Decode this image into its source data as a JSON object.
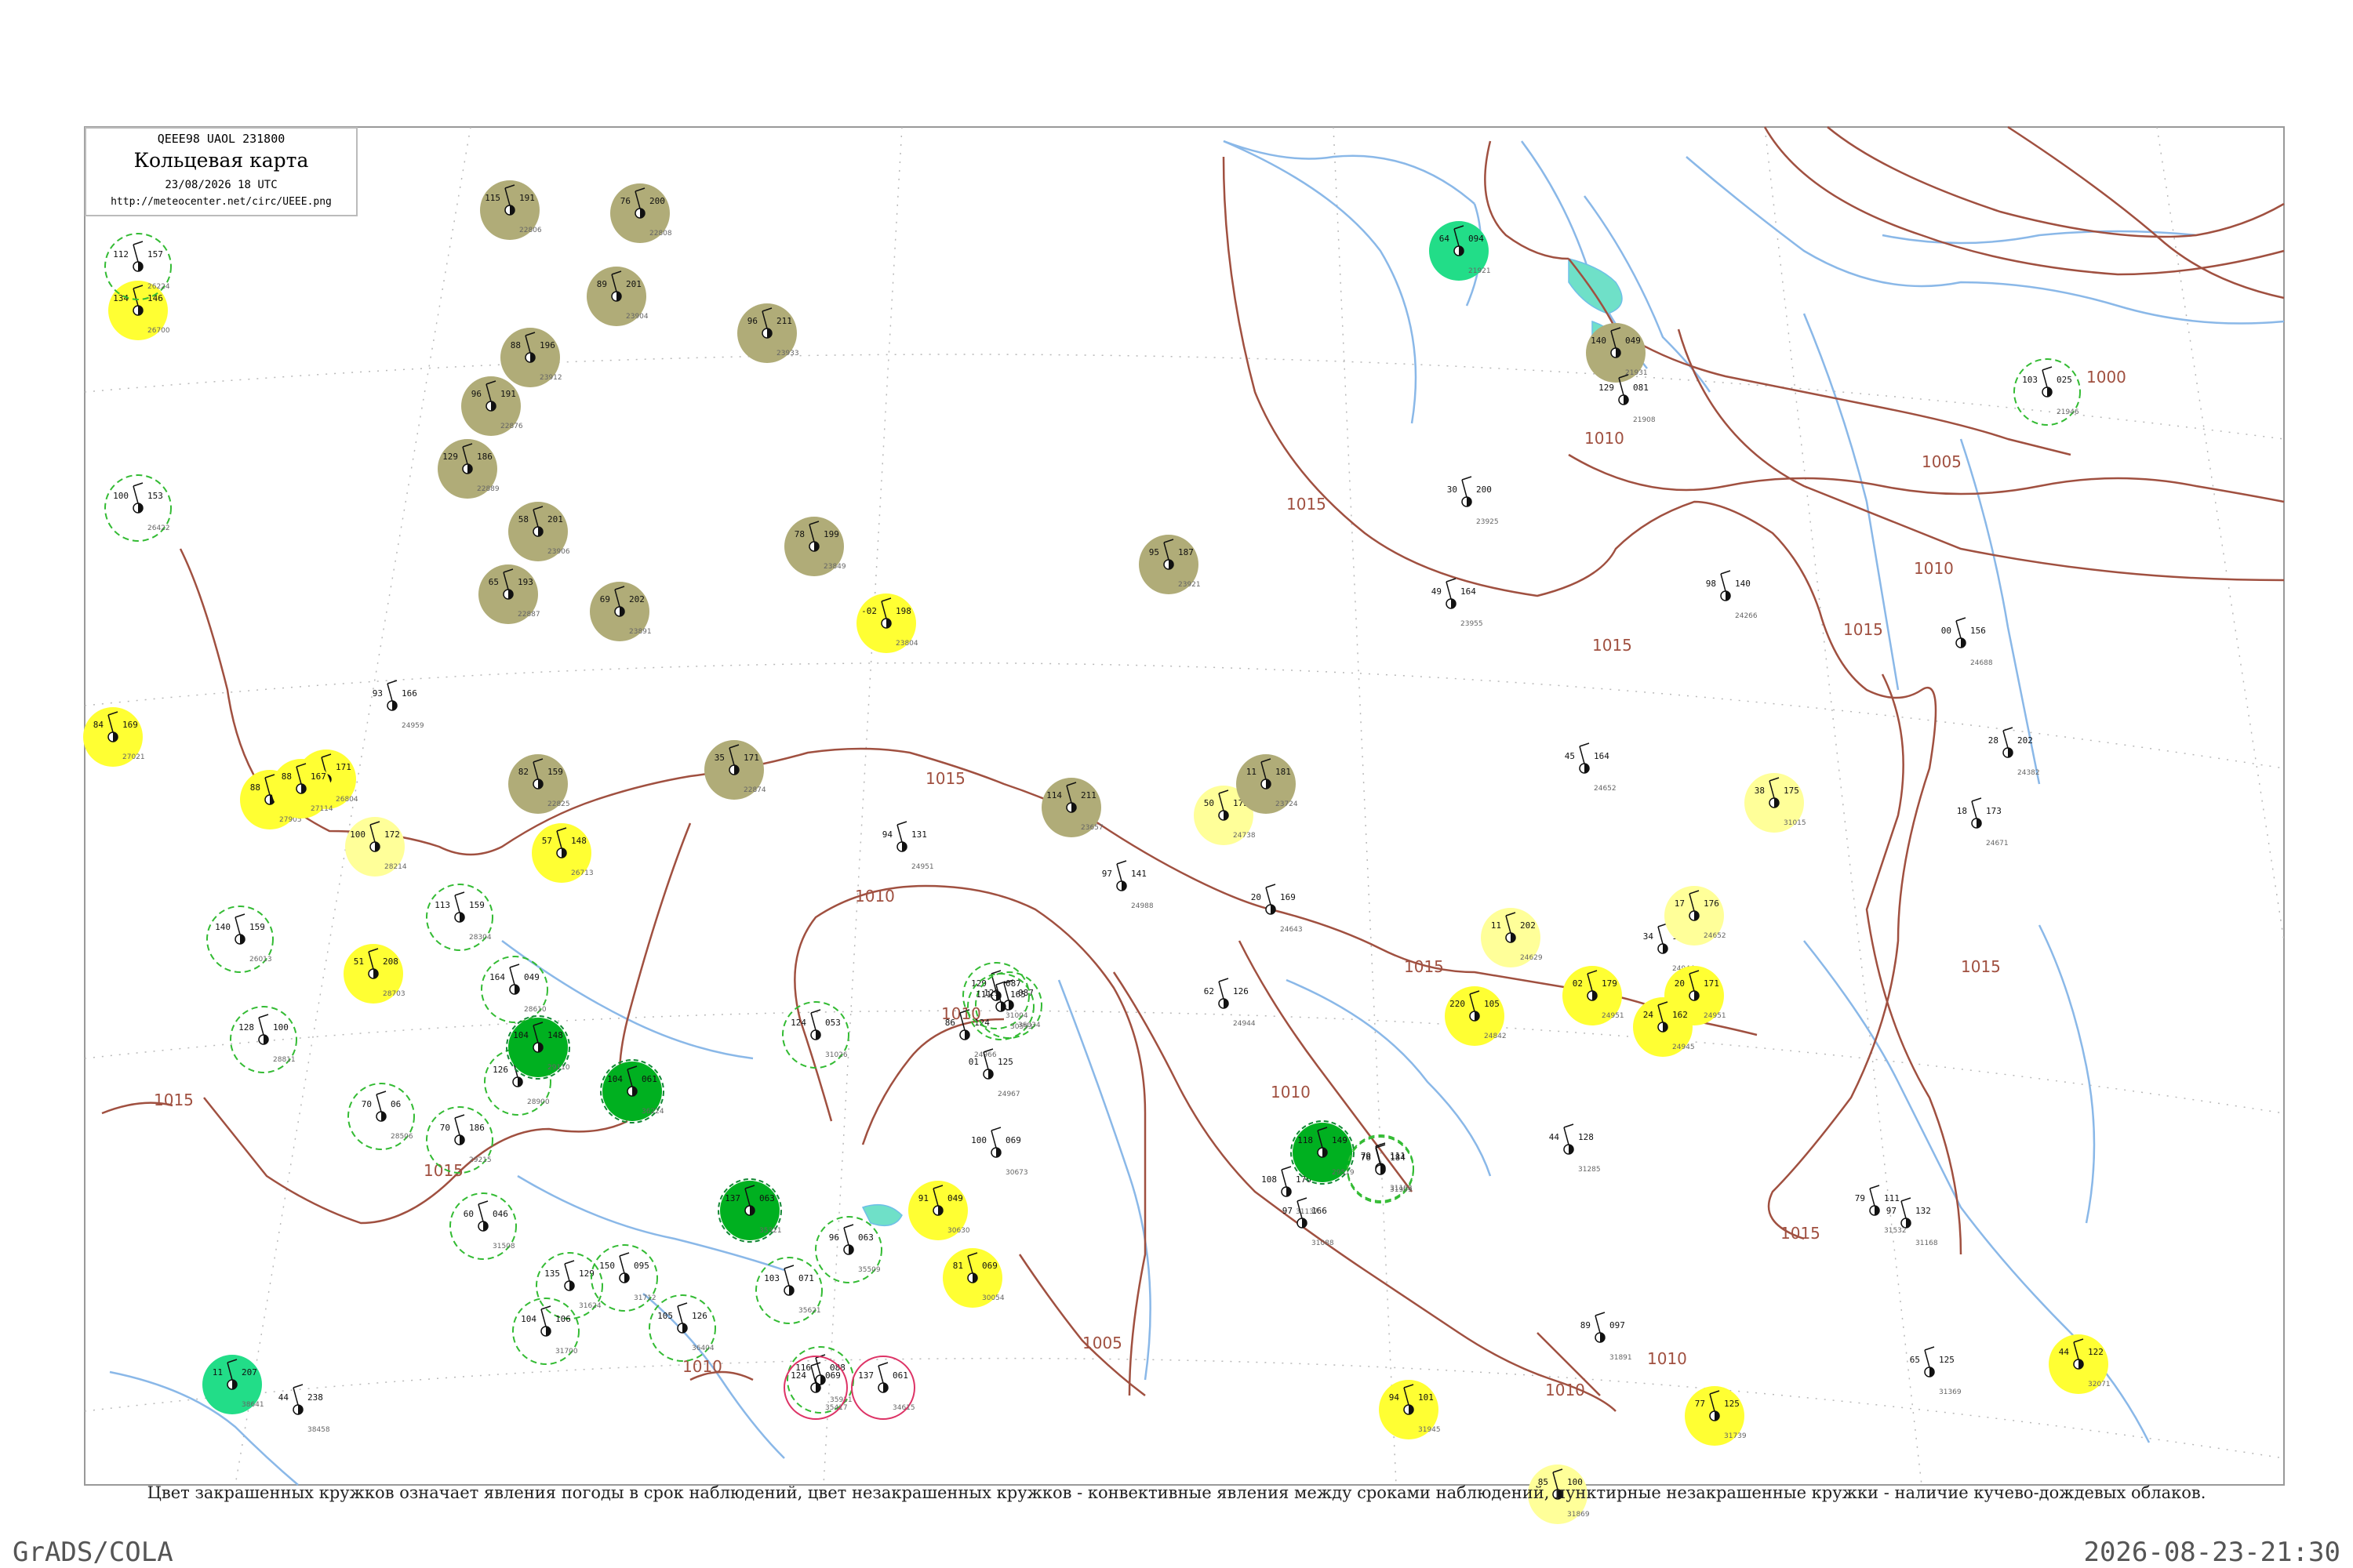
{
  "header": {
    "code_line": "QEEE98  UAOL  231800",
    "title": "Кольцевая карта",
    "datetime": "23/08/2026 18 UTC",
    "url": "http://meteocenter.net/circ/UEEE.png"
  },
  "caption": "Цвет закрашенных кружков означает явления погоды в срок наблюдений, цвет незакрашенных кружков - конвективные явления между сроками наблюдений, пунктирные незакрашенные кружки - наличие кучево-дождевых облаков.",
  "footer": {
    "left": "GrADS/COLA",
    "right": "2026-08-23-21:30"
  },
  "colors": {
    "isobar": "#a05040",
    "river": "#8ab8e8",
    "grid": "#b0b0b0",
    "frame": "#999999",
    "fog_fill": "#b0ac78",
    "haze_fill": "#ffff33",
    "pale_fill": "#ffff99",
    "rain_fill": "#00b020",
    "shower_fill": "#22dd88",
    "cb_ring": "#33bb33",
    "storm_ring": "#dd3366"
  },
  "isobar_labels": [
    "1015",
    "1015",
    "1015",
    "1015",
    "1015",
    "1015",
    "1015",
    "1015",
    "1015",
    "1010",
    "1010",
    "1010",
    "1010",
    "1010",
    "1010",
    "1010",
    "1010",
    "1005",
    "1005",
    "1000"
  ],
  "stations": [
    {
      "id": "24959",
      "t": "93",
      "p": "166"
    },
    {
      "id": "24951",
      "t": "94",
      "p": "131"
    },
    {
      "id": "24988",
      "t": "97",
      "p": "141"
    },
    {
      "id": "24944",
      "t": "62",
      "p": "126"
    },
    {
      "id": "24966",
      "t": "86",
      "p": "124"
    },
    {
      "id": "24967",
      "t": "01",
      "p": "125"
    },
    {
      "id": "31004",
      "t": "129",
      "p": "087"
    },
    {
      "id": "31026",
      "t": "124",
      "p": "053"
    },
    {
      "id": "30054",
      "t": "81",
      "p": "069"
    },
    {
      "id": "31137",
      "t": "108",
      "p": "176"
    },
    {
      "id": "31102",
      "t": "79",
      "p": "111"
    },
    {
      "id": "30673",
      "t": "100",
      "p": "069"
    },
    {
      "id": "31088",
      "t": "97",
      "p": "166"
    },
    {
      "id": "24266",
      "t": "98",
      "p": "140"
    },
    {
      "id": "24688",
      "t": "00",
      "p": "156"
    },
    {
      "id": "24382",
      "t": "28",
      "p": "202"
    },
    {
      "id": "24671",
      "t": "18",
      "p": "173"
    },
    {
      "id": "24738",
      "t": "50",
      "p": "173"
    },
    {
      "id": "24643",
      "t": "20",
      "p": "169"
    },
    {
      "id": "24652",
      "t": "45",
      "p": "164"
    },
    {
      "id": "24944",
      "t": "34",
      "p": "179"
    },
    {
      "id": "24951",
      "t": "02",
      "p": "179"
    },
    {
      "id": "31168",
      "t": "97",
      "p": "132"
    },
    {
      "id": "31369",
      "t": "65",
      "p": "125"
    },
    {
      "id": "21921",
      "t": "64",
      "p": "094"
    },
    {
      "id": "21946",
      "t": "103",
      "p": "025"
    },
    {
      "id": "21931",
      "t": "140",
      "p": "049"
    },
    {
      "id": "21908",
      "t": "129",
      "p": "081"
    },
    {
      "id": "23925",
      "t": "30",
      "p": "200"
    },
    {
      "id": "23955",
      "t": "49",
      "p": "164"
    },
    {
      "id": "23921",
      "t": "95",
      "p": "187"
    },
    {
      "id": "23804",
      "t": "-02",
      "p": "198"
    },
    {
      "id": "23849",
      "t": "78",
      "p": "199"
    },
    {
      "id": "23933",
      "t": "96",
      "p": "211"
    },
    {
      "id": "22887",
      "t": "65",
      "p": "193"
    },
    {
      "id": "23891",
      "t": "69",
      "p": "202"
    },
    {
      "id": "22806",
      "t": "115",
      "p": "191"
    },
    {
      "id": "22808",
      "t": "76",
      "p": "200"
    },
    {
      "id": "23904",
      "t": "89",
      "p": "201"
    },
    {
      "id": "23912",
      "t": "88",
      "p": "196"
    },
    {
      "id": "22876",
      "t": "96",
      "p": "191"
    },
    {
      "id": "22889",
      "t": "129",
      "p": "186"
    },
    {
      "id": "23906",
      "t": "58",
      "p": "201"
    },
    {
      "id": "22825",
      "t": "82",
      "p": "159"
    },
    {
      "id": "22874",
      "t": "35",
      "p": "171"
    },
    {
      "id": "23657",
      "t": "114",
      "p": "211"
    },
    {
      "id": "23724",
      "t": "11",
      "p": "181"
    },
    {
      "id": "26713",
      "t": "57",
      "p": "148"
    },
    {
      "id": "26804",
      "t": "100",
      "p": "171"
    },
    {
      "id": "27905",
      "t": "88",
      "p": "172"
    },
    {
      "id": "27114",
      "t": "88",
      "p": "167"
    },
    {
      "id": "28214",
      "t": "100",
      "p": "172"
    },
    {
      "id": "27021",
      "t": "84",
      "p": "169"
    },
    {
      "id": "26422",
      "t": "100",
      "p": "153"
    },
    {
      "id": "26700",
      "t": "134",
      "p": "146"
    },
    {
      "id": "26224",
      "t": "112",
      "p": "157"
    },
    {
      "id": "26013",
      "t": "140",
      "p": "159"
    },
    {
      "id": "28811",
      "t": "128",
      "p": "100"
    },
    {
      "id": "28703",
      "t": "51",
      "p": "208"
    },
    {
      "id": "28506",
      "t": "70",
      "p": "06"
    },
    {
      "id": "28304",
      "t": "113",
      "p": "159"
    },
    {
      "id": "28610",
      "t": "164",
      "p": "049"
    },
    {
      "id": "28900",
      "t": "126",
      "p": "132"
    },
    {
      "id": "29110",
      "t": "104",
      "p": "148"
    },
    {
      "id": "29215",
      "t": "70",
      "p": "186"
    },
    {
      "id": "29519",
      "t": "118",
      "p": "149"
    },
    {
      "id": "31508",
      "t": "60",
      "p": "046"
    },
    {
      "id": "31624",
      "t": "135",
      "p": "129"
    },
    {
      "id": "31712",
      "t": "150",
      "p": "095"
    },
    {
      "id": "31700",
      "t": "104",
      "p": "106"
    },
    {
      "id": "36404",
      "t": "105",
      "p": "126"
    },
    {
      "id": "35911",
      "t": "116",
      "p": "088"
    },
    {
      "id": "35621",
      "t": "103",
      "p": "071"
    },
    {
      "id": "35509",
      "t": "96",
      "p": "063"
    },
    {
      "id": "35321",
      "t": "137",
      "p": "063"
    },
    {
      "id": "35417",
      "t": "124",
      "p": "069"
    },
    {
      "id": "34615",
      "t": "137",
      "p": "061"
    },
    {
      "id": "36034",
      "t": "129",
      "p": "087"
    },
    {
      "id": "36224",
      "t": "104",
      "p": "061"
    },
    {
      "id": "30630",
      "t": "91",
      "p": "049"
    },
    {
      "id": "30553",
      "t": "111",
      "p": "165"
    },
    {
      "id": "38641",
      "t": "11",
      "p": "207"
    },
    {
      "id": "38458",
      "t": "44",
      "p": "238"
    },
    {
      "id": "31945",
      "t": "94",
      "p": "101"
    },
    {
      "id": "31739",
      "t": "77",
      "p": "125"
    },
    {
      "id": "31869",
      "t": "85",
      "p": "100"
    },
    {
      "id": "32071",
      "t": "44",
      "p": "122"
    },
    {
      "id": "24652",
      "t": "17",
      "p": "176"
    },
    {
      "id": "24951",
      "t": "20",
      "p": "171"
    },
    {
      "id": "24945",
      "t": "24",
      "p": "162"
    },
    {
      "id": "24842",
      "t": "220",
      "p": "105"
    },
    {
      "id": "24629",
      "t": "11",
      "p": "202"
    },
    {
      "id": "31015",
      "t": "38",
      "p": "175"
    },
    {
      "id": "31285",
      "t": "44",
      "p": "128"
    },
    {
      "id": "31532",
      "t": "79",
      "p": "111"
    },
    {
      "id": "31909",
      "t": "76",
      "p": "184"
    },
    {
      "id": "31891",
      "t": "89",
      "p": "097"
    }
  ]
}
